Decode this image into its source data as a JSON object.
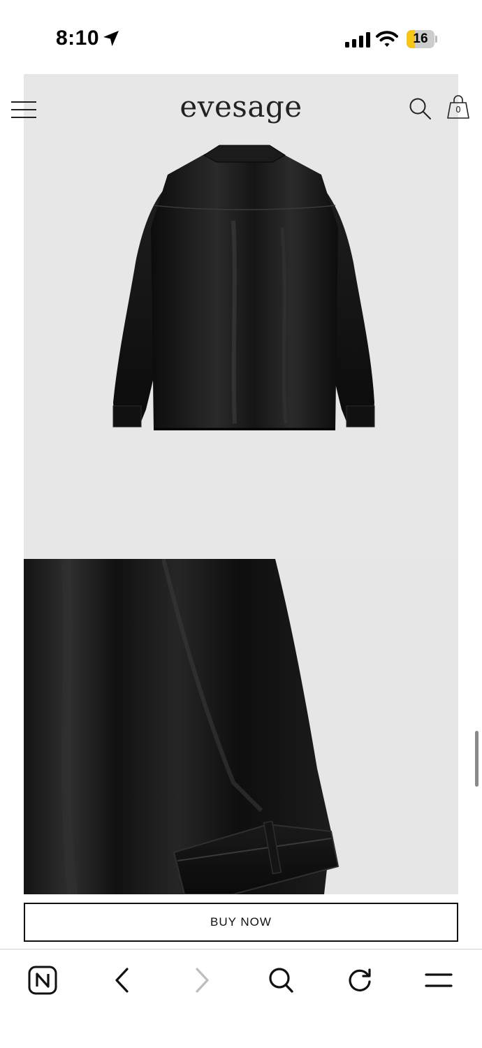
{
  "status_bar": {
    "time": "8:10",
    "battery_level": "16",
    "battery_percent": 16,
    "battery_color": "#f5c518",
    "icons": [
      "location-arrow-icon",
      "signal-bars-icon",
      "wifi-icon",
      "battery-icon"
    ]
  },
  "header": {
    "brand": "evesage",
    "cart_count": "0",
    "icons": [
      "hamburger-menu-icon",
      "search-icon",
      "shopping-bag-icon"
    ]
  },
  "gallery": {
    "images": [
      {
        "name": "jacket-back-view",
        "background": "#e7e7e7"
      },
      {
        "name": "jacket-sleeve-detail",
        "background": "#e6e6e6"
      }
    ]
  },
  "product": {
    "buy_label": "BUY NOW"
  },
  "toolbar": {
    "items": [
      "n-tab-icon",
      "back-chevron-icon",
      "forward-chevron-icon",
      "search-icon",
      "reload-icon",
      "menu-icon"
    ],
    "forward_enabled": false
  }
}
